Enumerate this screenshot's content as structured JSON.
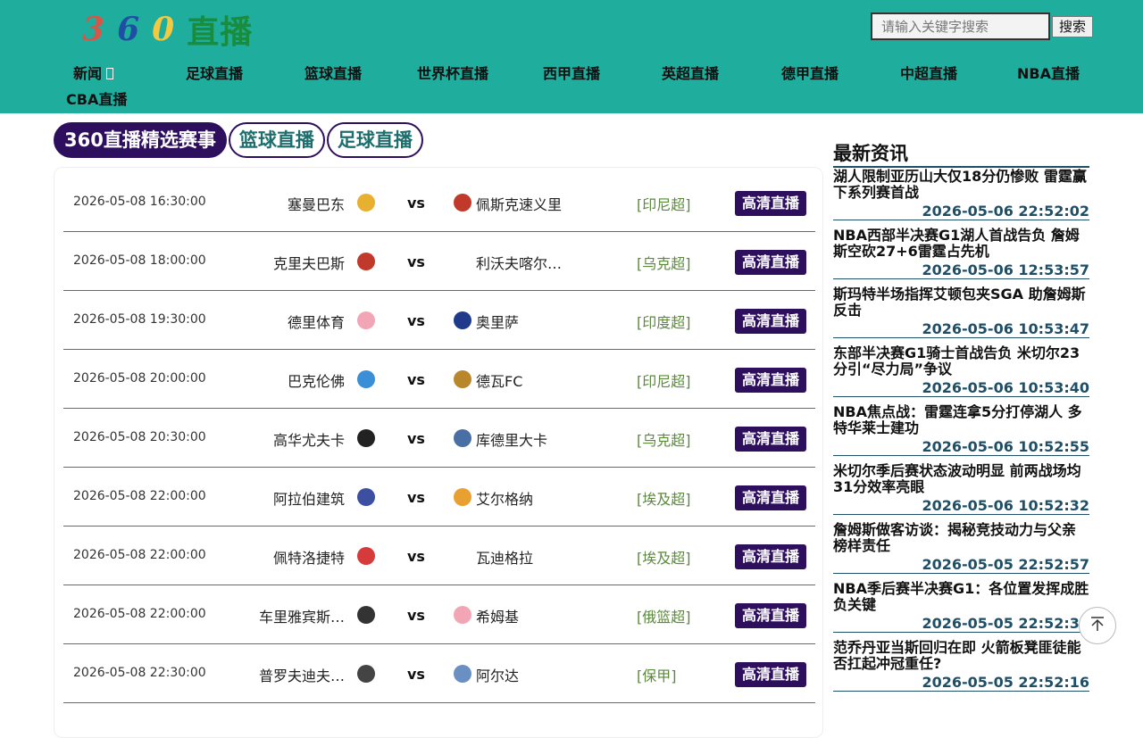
{
  "header": {
    "logo": {
      "d1": "3",
      "d2": "6",
      "d3": "0",
      "text": "直播"
    },
    "search": {
      "placeholder": "请输入关键字搜索",
      "button": "搜索"
    },
    "nav": [
      "新闻",
      "足球直播",
      "篮球直播",
      "世界杯直播",
      "西甲直播",
      "英超直播",
      "德甲直播",
      "中超直播",
      "NBA直播",
      "CBA直播"
    ]
  },
  "tabs": [
    "360直播精选赛事",
    "篮球直播",
    "足球直播"
  ],
  "matches": [
    {
      "time": "2026-05-08 16:30:00",
      "home": "塞曼巴东",
      "vs": "vs",
      "away": "佩斯克速义里",
      "league": "[印尼超]",
      "button": "高清直播"
    },
    {
      "time": "2026-05-08 18:00:00",
      "home": "克里夫巴斯",
      "vs": "vs",
      "away": "利沃夫喀尔…",
      "league": "[乌克超]",
      "button": "高清直播"
    },
    {
      "time": "2026-05-08 19:30:00",
      "home": "德里体育",
      "vs": "vs",
      "away": "奥里萨",
      "league": "[印度超]",
      "button": "高清直播"
    },
    {
      "time": "2026-05-08 20:00:00",
      "home": "巴克伦佛",
      "vs": "vs",
      "away": "德瓦FC",
      "league": "[印尼超]",
      "button": "高清直播"
    },
    {
      "time": "2026-05-08 20:30:00",
      "home": "高华尤夫卡",
      "vs": "vs",
      "away": "库德里大卡",
      "league": "[乌克超]",
      "button": "高清直播"
    },
    {
      "time": "2026-05-08 22:00:00",
      "home": "阿拉伯建筑",
      "vs": "vs",
      "away": "艾尔格纳",
      "league": "[埃及超]",
      "button": "高清直播"
    },
    {
      "time": "2026-05-08 22:00:00",
      "home": "佩特洛捷特",
      "vs": "vs",
      "away": "瓦迪格拉",
      "league": "[埃及超]",
      "button": "高清直播"
    },
    {
      "time": "2026-05-08 22:00:00",
      "home": "车里雅宾斯…",
      "vs": "vs",
      "away": "希姆基",
      "league": "[俄篮超]",
      "button": "高清直播"
    },
    {
      "time": "2026-05-08 22:30:00",
      "home": "普罗夫迪夫…",
      "vs": "vs",
      "away": "阿尔达",
      "league": "[保甲]",
      "button": "高清直播"
    }
  ],
  "team_logo_colors": {
    "home": [
      "#e8b030",
      "#c0392b",
      "#f2a6b5",
      "#3b8fd6",
      "#222222",
      "#3d4fa0",
      "#d63a3a",
      "#333333",
      "#444444"
    ],
    "away": [
      "#c0392b",
      null,
      "#1f3a8a",
      "#b8862b",
      "#4a6fa5",
      "#e8a030",
      null,
      "#f2a6b5",
      "#6a8fc2"
    ]
  },
  "news": {
    "title": "最新资讯",
    "items": [
      {
        "text": "湖人限制亚历山大仅18分仍惨败 雷霆赢下系列赛首战",
        "date": "2026-05-06 22:52:02"
      },
      {
        "text": "NBA西部半决赛G1湖人首战告负 詹姆斯空砍27+6雷霆占先机",
        "date": "2026-05-06 12:53:57"
      },
      {
        "text": "斯玛特半场指挥艾顿包夹SGA 助詹姆斯反击",
        "date": "2026-05-06 10:53:47"
      },
      {
        "text": "东部半决赛G1骑士首战告负 米切尔23分引“尽力局”争议",
        "date": "2026-05-06 10:53:40"
      },
      {
        "text": "NBA焦点战：雷霆连拿5分打停湖人 多特华莱士建功",
        "date": "2026-05-06 10:52:55"
      },
      {
        "text": "米切尔季后赛状态波动明显 前两战场均31分效率亮眼",
        "date": "2026-05-06 10:52:32"
      },
      {
        "text": "詹姆斯做客访谈：揭秘竞技动力与父亲榜样责任",
        "date": "2026-05-05 22:52:57"
      },
      {
        "text": "NBA季后赛半决赛G1：各位置发挥成胜负关键",
        "date": "2026-05-05 22:52:30"
      },
      {
        "text": "范乔丹亚当斯回归在即 火箭板凳匪徒能否扛起冲冠重任?",
        "date": "2026-05-05 22:52:16"
      }
    ]
  },
  "totop_icon": "arrow-up-icon"
}
